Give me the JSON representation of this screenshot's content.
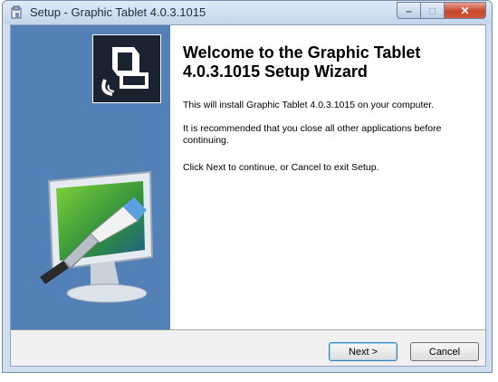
{
  "window": {
    "title": "Setup - Graphic Tablet 4.0.3.1015",
    "minimize_glyph": "–",
    "maximize_glyph": "□",
    "close_glyph": "✕"
  },
  "main": {
    "heading": "Welcome to the Graphic Tablet 4.0.3.1015 Setup Wizard",
    "install_text": "This will install Graphic Tablet 4.0.3.1015 on your computer.",
    "recommend_text": "It is recommended that you close all other applications before continuing.",
    "continue_text": "Click Next to continue, or Cancel to exit Setup."
  },
  "buttons": {
    "next": "Next >",
    "cancel": "Cancel"
  },
  "icons": {
    "title_icon": "setup-installer-icon",
    "logo": "tablet-logo-icon",
    "illustration": "monitor-brush-illustration"
  },
  "colors": {
    "sidebar": "#5381b7",
    "close_button": "#c7462d",
    "accent_border": "#3c7fb1"
  }
}
